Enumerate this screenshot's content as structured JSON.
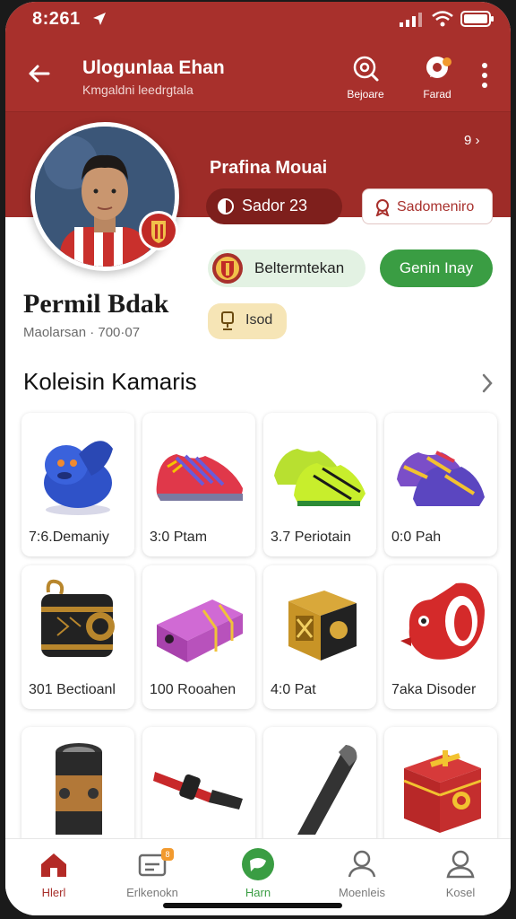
{
  "status": {
    "time": "8:261"
  },
  "appbar": {
    "title": "Ulogunlaa Ehan",
    "subtitle": "Kmgaldni leedrgtala",
    "actions": [
      {
        "label": "Bejoare",
        "icon": "target-icon"
      },
      {
        "label": "Farad",
        "icon": "chat-icon"
      }
    ]
  },
  "hero": {
    "rating_link": "9",
    "profile_label": "Prafina Mouai",
    "score_pill": "Sador 23",
    "subscribe_button": "Sadomeniro"
  },
  "user": {
    "name": "Permil Bdak",
    "meta": "Maolarsan · 700·07"
  },
  "chips": {
    "team": "Beltermtekan",
    "green_button": "Genin Inay",
    "gold": "Isod"
  },
  "collection": {
    "title": "Koleisin Kamaris",
    "items": [
      {
        "label": "7:6.Demaniy",
        "icon": "blue-creature-figurine-icon"
      },
      {
        "label": "3:0 Ptam",
        "icon": "red-sneaker-icon"
      },
      {
        "label": "3.7 Periotain",
        "icon": "green-boots-icon"
      },
      {
        "label": "0:0 Pah",
        "icon": "purple-cleats-icon"
      },
      {
        "label": "301 Bectioanl",
        "icon": "lantern-box-icon"
      },
      {
        "label": "100 Rooahen",
        "icon": "purple-case-icon"
      },
      {
        "label": "4:0 Pat",
        "icon": "gold-cube-icon"
      },
      {
        "label": "7aka Disoder",
        "icon": "red-dragon-icon"
      },
      {
        "label": "",
        "icon": "canister-icon"
      },
      {
        "label": "",
        "icon": "flute-icon"
      },
      {
        "label": "",
        "icon": "baton-icon"
      },
      {
        "label": "",
        "icon": "red-chest-icon"
      }
    ]
  },
  "bottom_nav": [
    {
      "label": "Hlerl",
      "icon": "home-icon",
      "active": true
    },
    {
      "label": "Erlkenokn",
      "icon": "ticket-icon",
      "badge": "8"
    },
    {
      "label": "Harn",
      "icon": "chat-bubble-icon"
    },
    {
      "label": "Moenleis",
      "icon": "person-icon"
    },
    {
      "label": "Kosel",
      "icon": "profile-icon"
    }
  ],
  "colors": {
    "brand": "#a8302c",
    "green": "#3a9d43",
    "gold": "#f6e5b6"
  }
}
